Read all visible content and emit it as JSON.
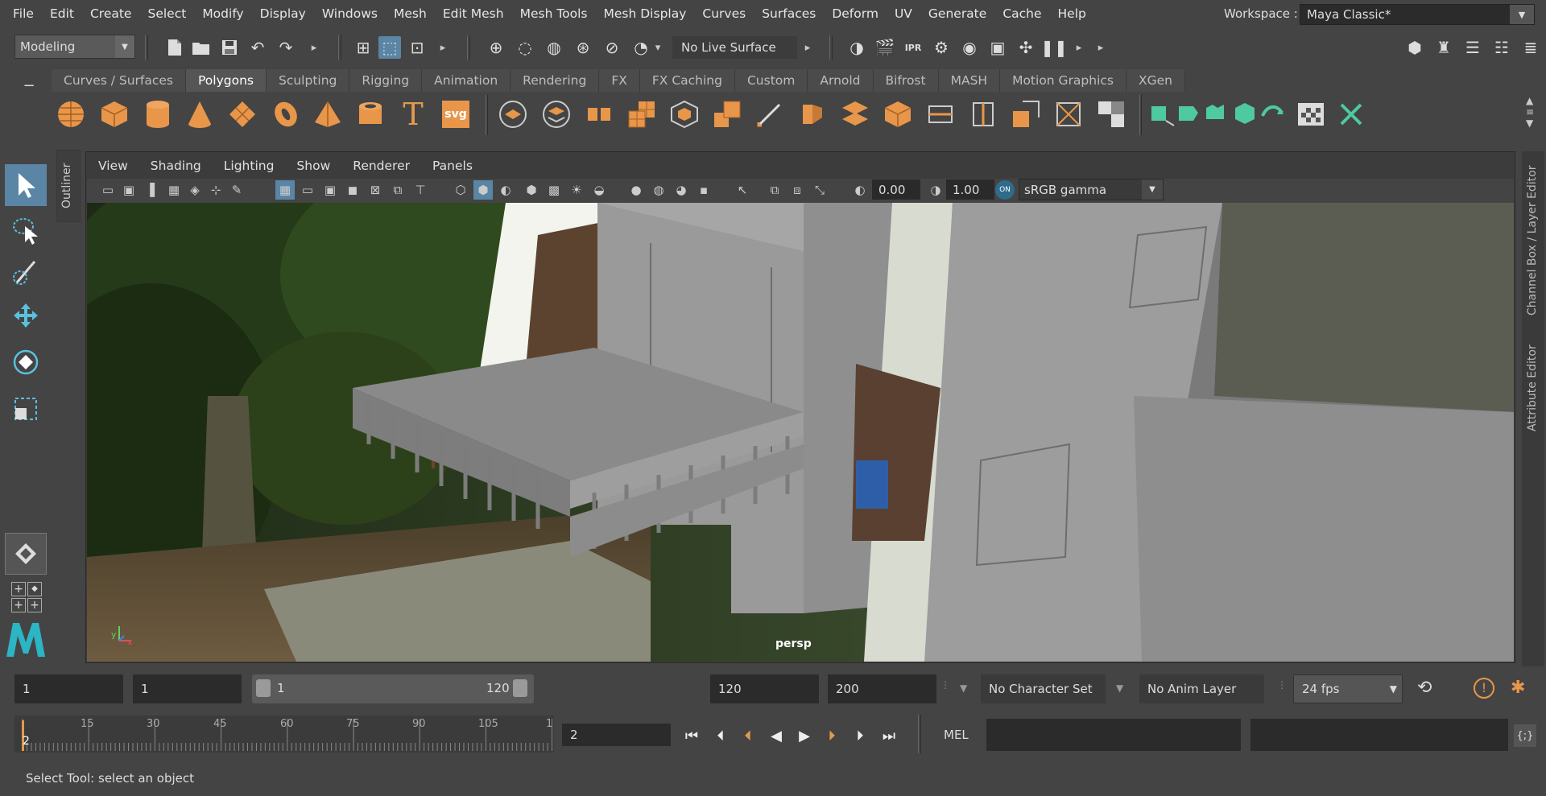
{
  "menubar": {
    "items": [
      "File",
      "Edit",
      "Create",
      "Select",
      "Modify",
      "Display",
      "Windows",
      "Mesh",
      "Edit Mesh",
      "Mesh Tools",
      "Mesh Display",
      "Curves",
      "Surfaces",
      "Deform",
      "UV",
      "Generate",
      "Cache",
      "Help"
    ],
    "workspace_label": "Workspace :",
    "workspace_value": "Maya Classic*"
  },
  "statusline": {
    "mode": "Modeling",
    "live_surface": "No Live Surface"
  },
  "shelf": {
    "tabs": [
      "Curves / Surfaces",
      "Polygons",
      "Sculpting",
      "Rigging",
      "Animation",
      "Rendering",
      "FX",
      "FX Caching",
      "Custom",
      "Arnold",
      "Bifrost",
      "MASH",
      "Motion Graphics",
      "XGen"
    ],
    "active_tab": "Polygons",
    "text_tool_label": "T",
    "svg_tool_label": "svg"
  },
  "outliner": {
    "label": "Outliner"
  },
  "viewport": {
    "menus": [
      "View",
      "Shading",
      "Lighting",
      "Show",
      "Renderer",
      "Panels"
    ],
    "exposure": "0.00",
    "gamma": "1.00",
    "color_space": "sRGB gamma",
    "camera_label": "persp",
    "axis_y": "y",
    "axis_x": "x"
  },
  "right_tabs": {
    "channel_box": "Channel Box / Layer Editor",
    "attribute_editor": "Attribute Editor"
  },
  "range_slider": {
    "start_time": "1",
    "playback_start": "1",
    "range_start": "1",
    "range_end": "120",
    "playback_end": "120",
    "end_time": "200",
    "character_set": "No Character Set",
    "anim_layer": "No Anim Layer",
    "fps": "24 fps"
  },
  "timeline": {
    "ticks": [
      "15",
      "30",
      "45",
      "60",
      "75",
      "90",
      "105",
      "1"
    ],
    "current_marker": "2",
    "current_frame": "2"
  },
  "command_line": {
    "label": "MEL"
  },
  "help_line": {
    "text": "Select Tool: select an object"
  }
}
